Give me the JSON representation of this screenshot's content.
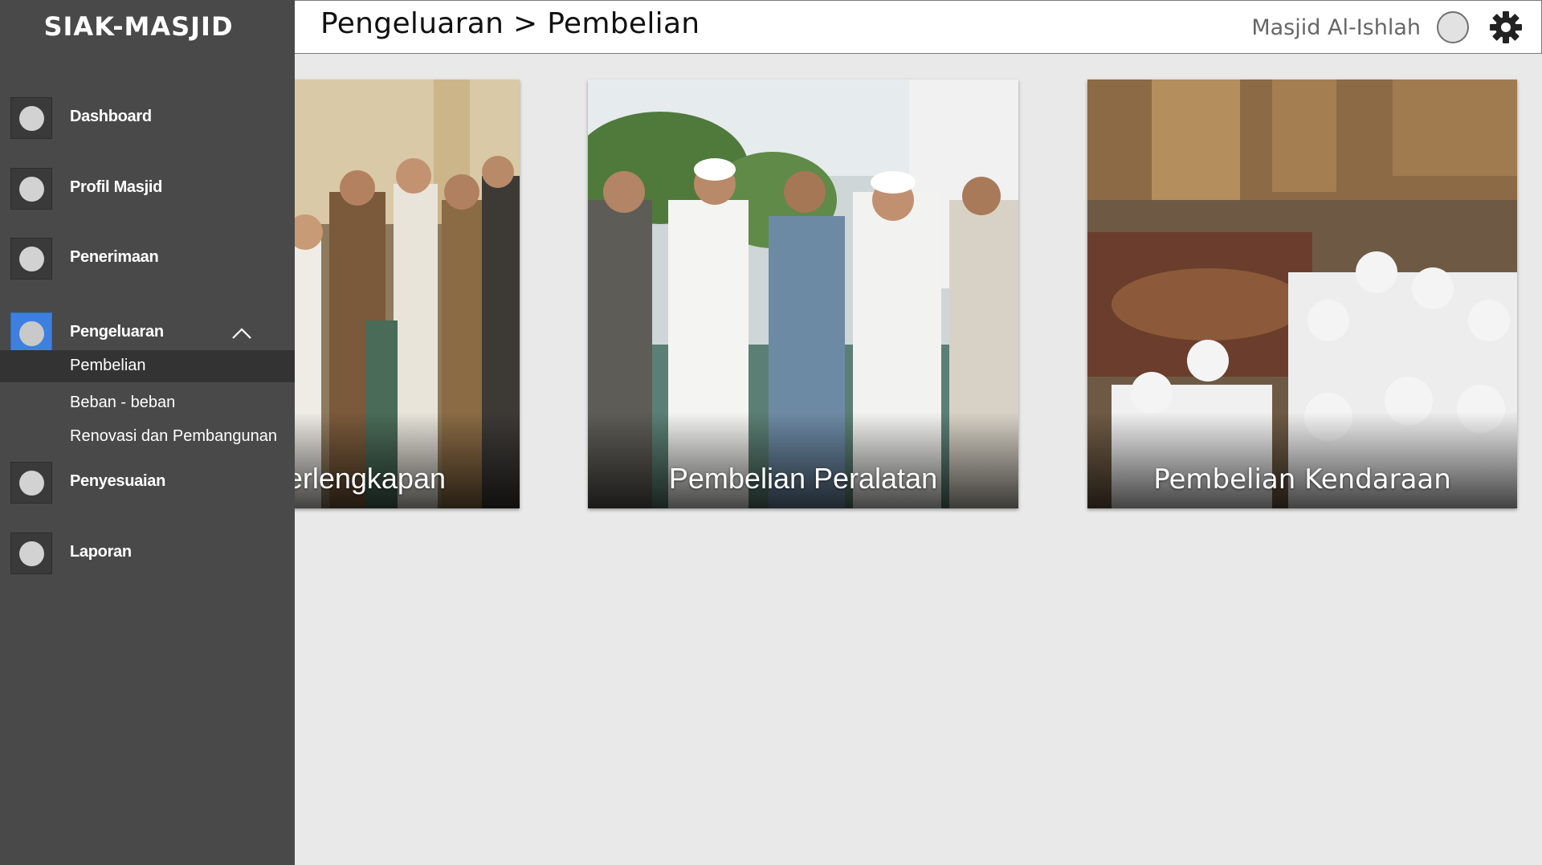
{
  "app": {
    "brand": "SIAK-MASJID"
  },
  "header": {
    "breadcrumb": "Pengeluaran > Pembelian",
    "mosque_name": "Masjid Al-Ishlah"
  },
  "sidebar": {
    "items": [
      {
        "label": "Dashboard"
      },
      {
        "label": "Profil Masjid"
      },
      {
        "label": "Penerimaan"
      },
      {
        "label": "Pengeluaran",
        "expanded": true,
        "children": [
          {
            "label": "Pembelian",
            "selected": true
          },
          {
            "label": "Beban - beban"
          },
          {
            "label": "Renovasi dan Pembangunan"
          }
        ]
      },
      {
        "label": "Penyesuaian"
      },
      {
        "label": "Laporan"
      }
    ]
  },
  "cards": [
    {
      "caption": "erlengkapan",
      "icon": "photo-congregation-praying"
    },
    {
      "caption": "Pembelian Peralatan",
      "icon": "photo-men-greeting"
    },
    {
      "caption": "Pembelian Kendaraan",
      "icon": "photo-gathering-seated"
    }
  ],
  "colors": {
    "sidebar_bg": "#494949",
    "active_accent": "#3f7fe0",
    "selected_sub_bg": "#333333",
    "content_bg": "#e9e9e9"
  }
}
